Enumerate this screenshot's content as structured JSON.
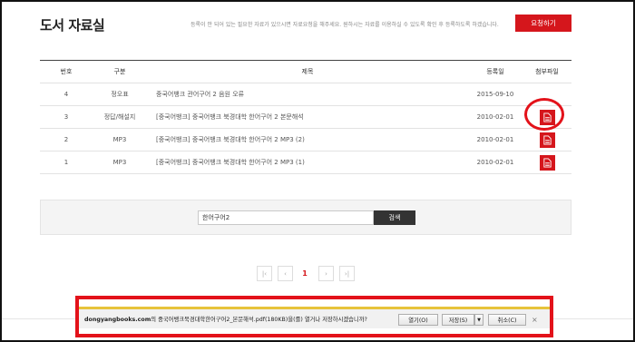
{
  "page": {
    "title": "도서 자료실",
    "notice": "등록이 안 되어 있는 필요한 자료가 있으시면 자료요청을 해주세요. 원하시는 자료를 이용하실 수 있도록 확인 후 등록하도록 하겠습니다.",
    "request_button": "요청하기"
  },
  "table": {
    "headers": {
      "no": "번호",
      "type": "구분",
      "title": "제목",
      "date": "등록일",
      "file": "첨부파일"
    },
    "rows": [
      {
        "no": "4",
        "type": "정오표",
        "title": "중국어뱅크 관어구어 2 음원 오류",
        "date": "2015-09-10",
        "has_file": false
      },
      {
        "no": "3",
        "type": "정답/해설지",
        "title": "[중국어뱅크] 중국어뱅크 북경대학 한어구어 2 본문해석",
        "date": "2010-02-01",
        "has_file": true
      },
      {
        "no": "2",
        "type": "MP3",
        "title": "[중국어뱅크] 중국어뱅크 북경대학 한어구어 2 MP3 (2)",
        "date": "2010-02-01",
        "has_file": true
      },
      {
        "no": "1",
        "type": "MP3",
        "title": "[중국어뱅크] 중국어뱅크 북경대학 한어구어 2 MP3 (1)",
        "date": "2010-02-01",
        "has_file": true
      }
    ]
  },
  "search": {
    "value": "한어구어2",
    "button": "검색"
  },
  "pagination": {
    "first": "|‹",
    "prev": "‹",
    "current": "1",
    "next": "›",
    "last": "›|"
  },
  "download_bar": {
    "site": "dongyangbooks.com",
    "message_prefix": "의 중국어뱅크북경대학한어구어2_본문해석.pdf",
    "message_suffix": "(180KB)을(를) 열거나 저장하시겠습니까?",
    "open": "열기(O)",
    "save": "저장(S)",
    "save_arrow": "▼",
    "cancel": "취소(C)",
    "close": "×"
  },
  "colors": {
    "accent": "#d5161c",
    "highlight": "#e3121a",
    "download_bar_top": "#e7c33b"
  }
}
